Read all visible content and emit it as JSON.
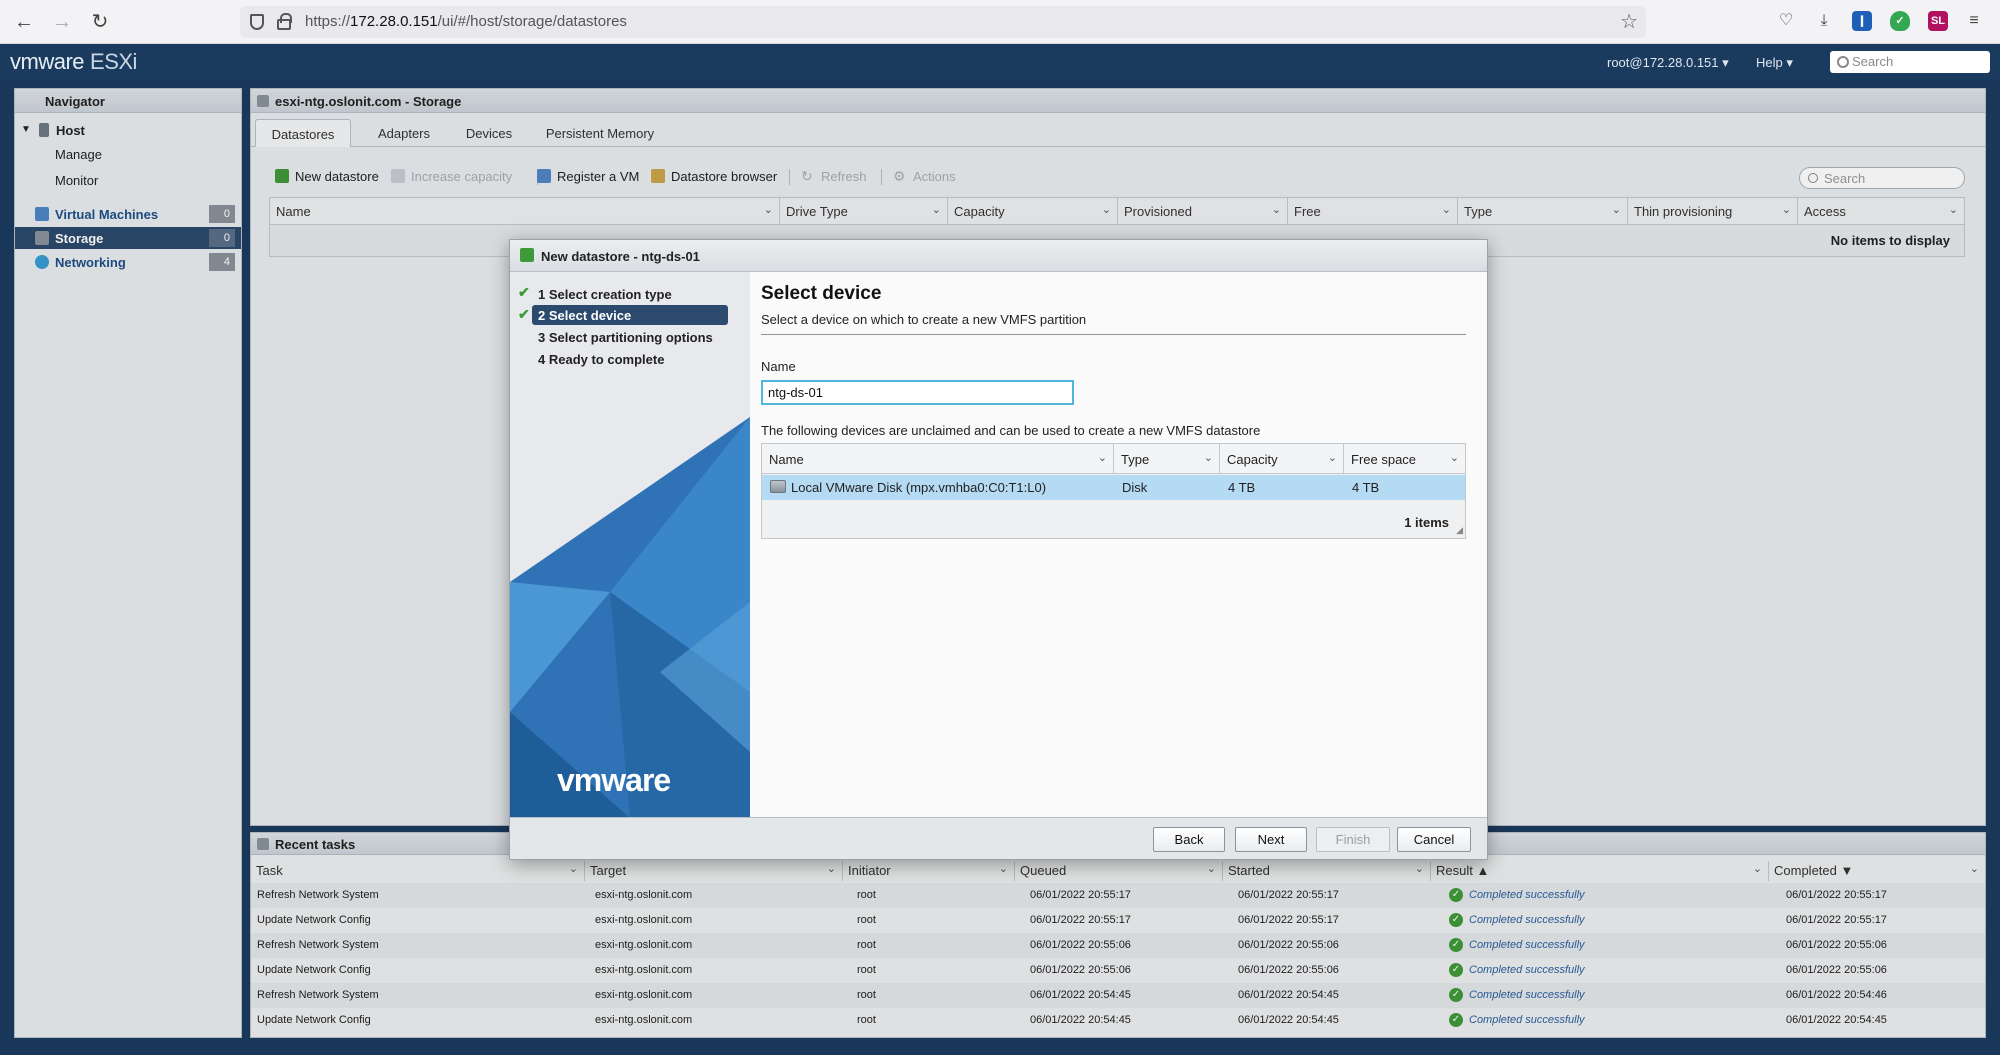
{
  "browser": {
    "url_prefix": "https://",
    "url_host": "172.28.0.151",
    "url_path": "/ui/#/host/storage/datastores",
    "ext_badge": "SL"
  },
  "header": {
    "brand": "vmware",
    "product": "ESXi",
    "user": "root@172.28.0.151",
    "help": "Help",
    "search_placeholder": "Search"
  },
  "navigator": {
    "title": "Navigator",
    "host": "Host",
    "manage": "Manage",
    "monitor": "Monitor",
    "items": [
      {
        "label": "Virtual Machines",
        "count": "0"
      },
      {
        "label": "Storage",
        "count": "0"
      },
      {
        "label": "Networking",
        "count": "4"
      }
    ]
  },
  "main": {
    "title": "esxi-ntg.oslonit.com - Storage",
    "tabs": [
      "Datastores",
      "Adapters",
      "Devices",
      "Persistent Memory"
    ],
    "toolbar": {
      "new_datastore": "New datastore",
      "increase_capacity": "Increase capacity",
      "register_vm": "Register a VM",
      "datastore_browser": "Datastore browser",
      "refresh": "Refresh",
      "actions": "Actions"
    },
    "search_placeholder": "Search",
    "columns": [
      "Name",
      "Drive Type",
      "Capacity",
      "Provisioned",
      "Free",
      "Type",
      "Thin provisioning",
      "Access"
    ],
    "empty_text": "No items to display"
  },
  "tasks": {
    "title": "Recent tasks",
    "columns": [
      "Task",
      "Target",
      "Initiator",
      "Queued",
      "Started",
      "Result ▲",
      "Completed ▼"
    ],
    "rows": [
      {
        "task": "Refresh Network System",
        "target": "esxi-ntg.oslonit.com",
        "initiator": "root",
        "queued": "06/01/2022 20:55:17",
        "started": "06/01/2022 20:55:17",
        "result": "Completed successfully",
        "completed": "06/01/2022 20:55:17"
      },
      {
        "task": "Update Network Config",
        "target": "esxi-ntg.oslonit.com",
        "initiator": "root",
        "queued": "06/01/2022 20:55:17",
        "started": "06/01/2022 20:55:17",
        "result": "Completed successfully",
        "completed": "06/01/2022 20:55:17"
      },
      {
        "task": "Refresh Network System",
        "target": "esxi-ntg.oslonit.com",
        "initiator": "root",
        "queued": "06/01/2022 20:55:06",
        "started": "06/01/2022 20:55:06",
        "result": "Completed successfully",
        "completed": "06/01/2022 20:55:06"
      },
      {
        "task": "Update Network Config",
        "target": "esxi-ntg.oslonit.com",
        "initiator": "root",
        "queued": "06/01/2022 20:55:06",
        "started": "06/01/2022 20:55:06",
        "result": "Completed successfully",
        "completed": "06/01/2022 20:55:06"
      },
      {
        "task": "Refresh Network System",
        "target": "esxi-ntg.oslonit.com",
        "initiator": "root",
        "queued": "06/01/2022 20:54:45",
        "started": "06/01/2022 20:54:45",
        "result": "Completed successfully",
        "completed": "06/01/2022 20:54:46"
      },
      {
        "task": "Update Network Config",
        "target": "esxi-ntg.oslonit.com",
        "initiator": "root",
        "queued": "06/01/2022 20:54:45",
        "started": "06/01/2022 20:54:45",
        "result": "Completed successfully",
        "completed": "06/01/2022 20:54:45"
      }
    ]
  },
  "dialog": {
    "title": "New datastore - ntg-ds-01",
    "steps": [
      {
        "label": "1 Select creation type",
        "done": true
      },
      {
        "label": "2 Select device",
        "done": true
      },
      {
        "label": "3 Select partitioning options",
        "done": false
      },
      {
        "label": "4 Ready to complete",
        "done": false
      }
    ],
    "logo": "vmware",
    "heading": "Select device",
    "subtitle": "Select a device on which to create a new VMFS partition",
    "name_label": "Name",
    "name_value": "ntg-ds-01",
    "devices_desc": "The following devices are unclaimed and can be used to create a new VMFS datastore",
    "device_columns": [
      "Name",
      "Type",
      "Capacity",
      "Free space"
    ],
    "devices": [
      {
        "name": "Local VMware Disk (mpx.vmhba0:C0:T1:L0)",
        "type": "Disk",
        "capacity": "4 TB",
        "free": "4 TB"
      }
    ],
    "items_count": "1 items",
    "buttons": {
      "back": "Back",
      "next": "Next",
      "finish": "Finish",
      "cancel": "Cancel"
    }
  },
  "colors": {
    "header_bg": "#1b3b5e",
    "selected_nav": "#2c4a6d",
    "selected_row": "#b5daf3",
    "success": "#3f9a3a",
    "input_focus": "#52b6dc"
  }
}
